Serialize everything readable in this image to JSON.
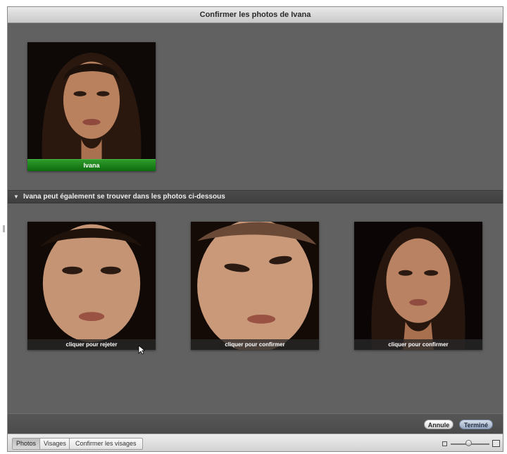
{
  "window": {
    "title": "Confirmer les photos de Ivana"
  },
  "confirmed": {
    "name": "Ivana"
  },
  "section": {
    "label": "Ivana peut également se trouver dans les photos ci-dessous"
  },
  "candidates": [
    {
      "action": "cliquer pour rejeter"
    },
    {
      "action": "cliquer pour confirmer"
    },
    {
      "action": "cliquer pour confirmer"
    }
  ],
  "buttons": {
    "cancel": "Annule",
    "done": "Terminé"
  },
  "toolbar": {
    "view_tabs": [
      "Photos",
      "Visages"
    ],
    "active_tab": "Photos",
    "confirm_faces": "Confirmer les visages",
    "zoom_level": 0.45
  },
  "colors": {
    "background": "#616161",
    "name_tag": "#1f8a1f",
    "section_bar": "#454545",
    "done_button": "#aab6cb"
  }
}
